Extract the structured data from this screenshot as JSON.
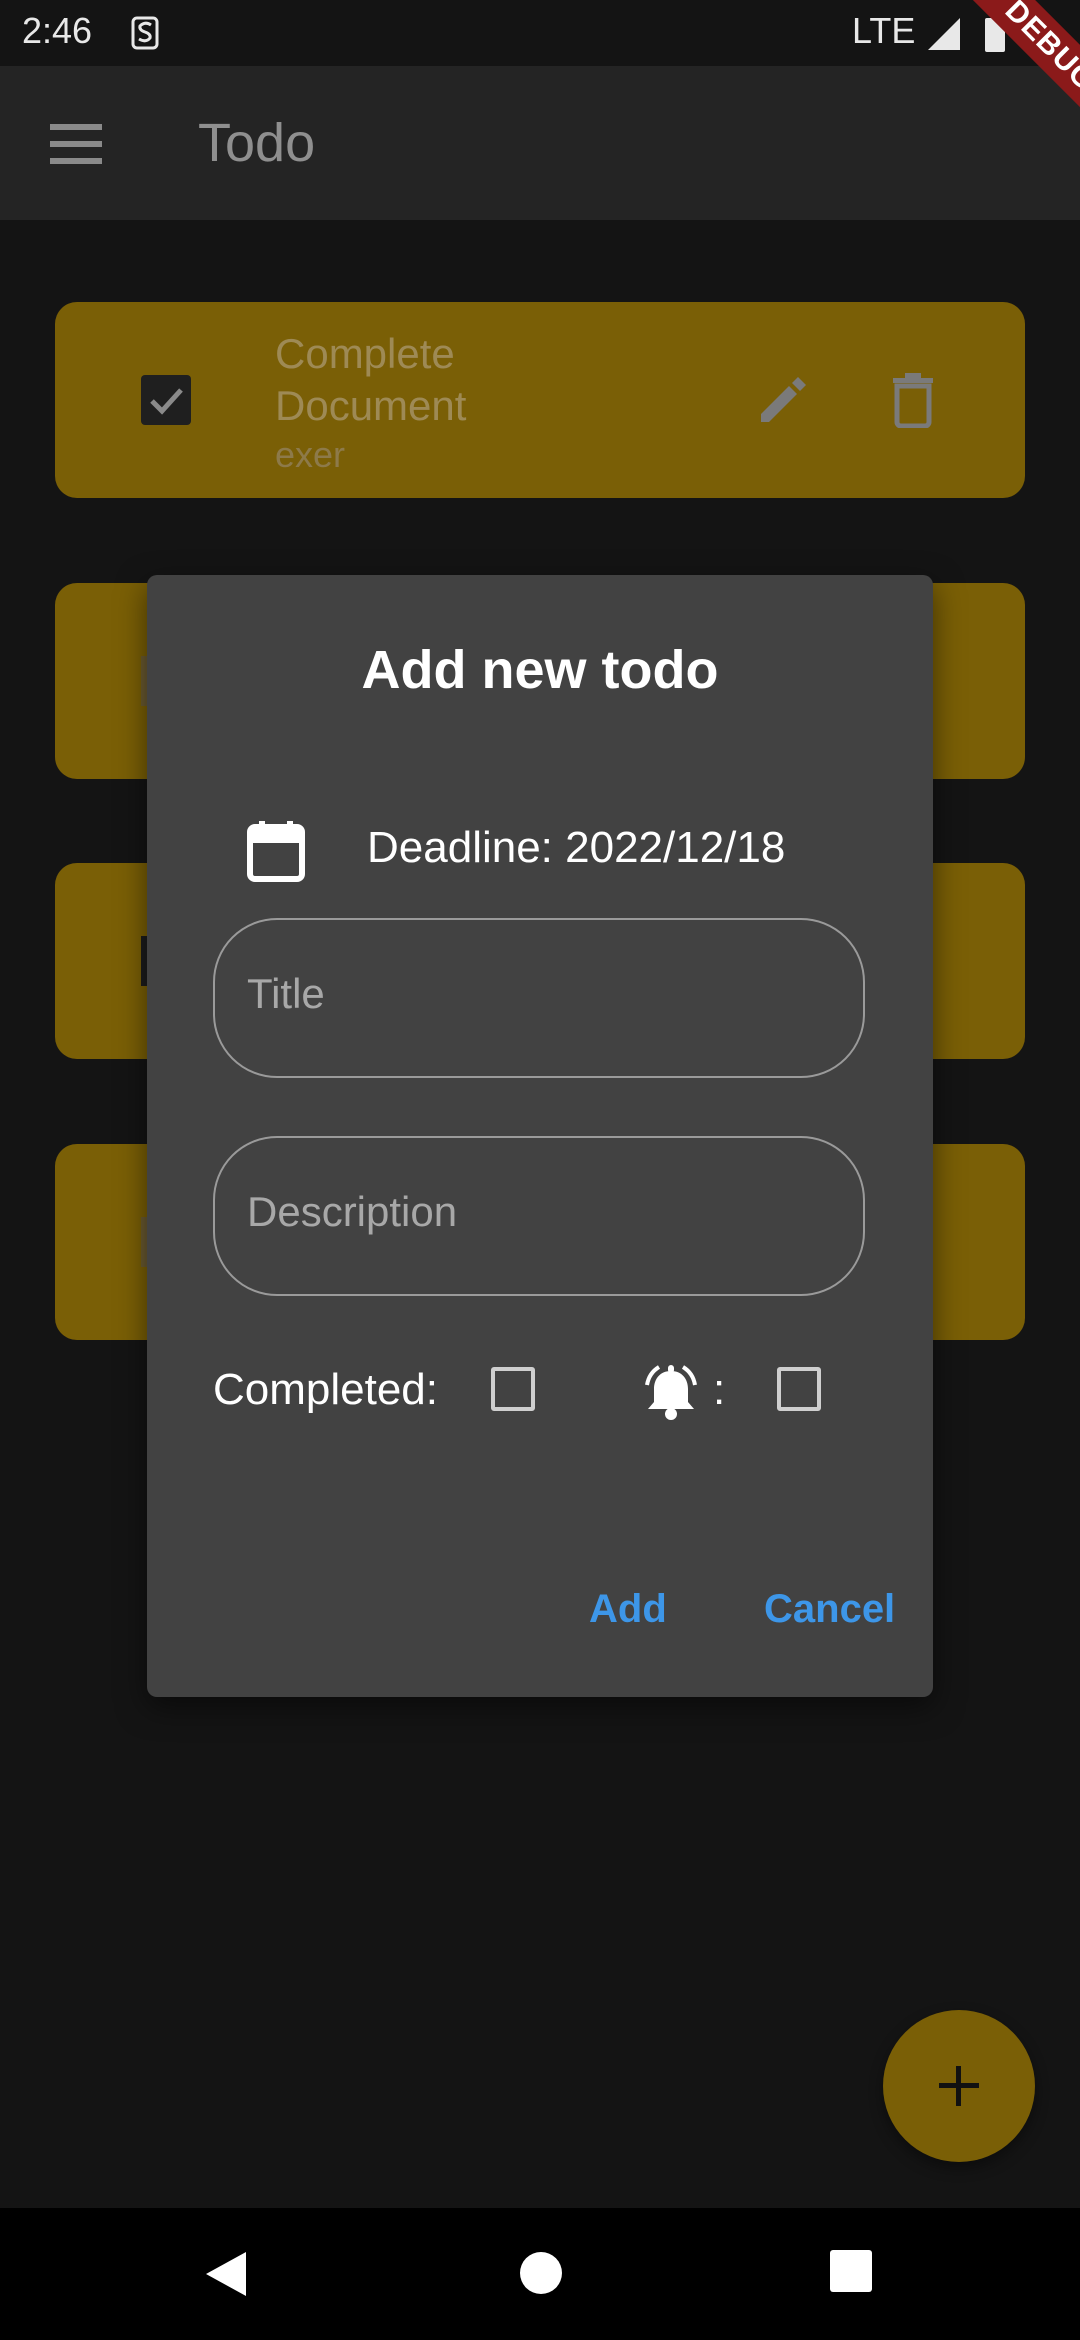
{
  "status_bar": {
    "time": "2:46",
    "network": "LTE",
    "debug_ribbon": "DEBUG"
  },
  "app_bar": {
    "title": "Todo"
  },
  "todos": [
    {
      "title": "Complete Document",
      "description": "exer",
      "completed": true
    }
  ],
  "dialog": {
    "title": "Add new todo",
    "deadline": "Deadline: 2022/12/18",
    "title_placeholder": "Title",
    "description_placeholder": "Description",
    "completed_label": "Completed:",
    "alarm_separator": ":",
    "add_label": "Add",
    "cancel_label": "Cancel"
  },
  "colors": {
    "accent": "#3d96e8",
    "card": "#7a5f06",
    "dialog": "#424242"
  },
  "icons": [
    "menu-icon",
    "calendar-icon",
    "alarm-icon",
    "edit-icon",
    "delete-icon",
    "plus-icon",
    "nav-back-icon",
    "nav-home-icon",
    "nav-recents-icon"
  ]
}
